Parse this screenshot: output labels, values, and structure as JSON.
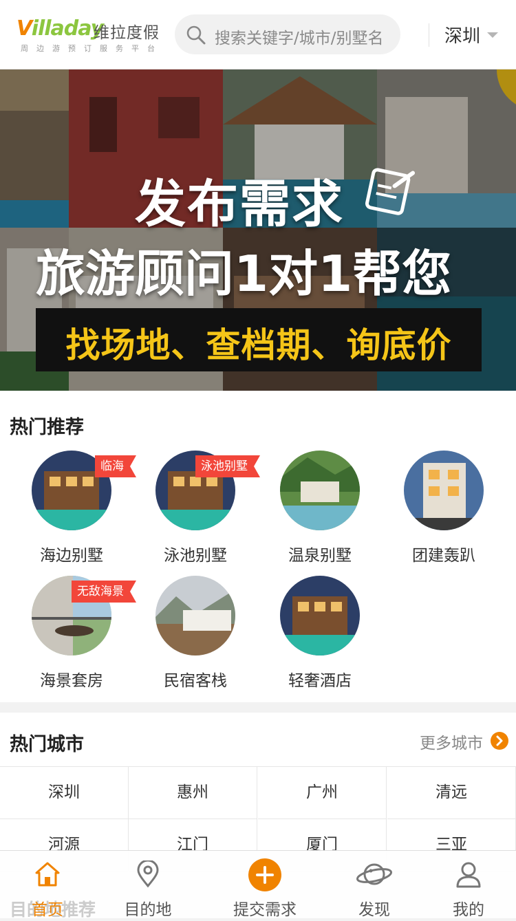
{
  "header": {
    "logo_en_v": "V",
    "logo_en_rest": "illaday",
    "logo_cn": "维拉度假",
    "logo_sub": "周边游预订服务平台",
    "search_placeholder": "搜索关键字/城市/别墅名",
    "city": "深圳"
  },
  "banner": {
    "title": "发布需求",
    "subtitle": "旅游顾问1对1帮您",
    "tagline": "找场地、查档期、询底价"
  },
  "recommend": {
    "title": "热门推荐",
    "items": [
      {
        "label": "海边别墅",
        "tag": "临海"
      },
      {
        "label": "泳池别墅",
        "tag": "泳池别墅"
      },
      {
        "label": "温泉别墅",
        "tag": ""
      },
      {
        "label": "团建轰趴",
        "tag": ""
      },
      {
        "label": "海景套房",
        "tag": "无敌海景"
      },
      {
        "label": "民宿客栈",
        "tag": ""
      },
      {
        "label": "轻奢酒店",
        "tag": ""
      }
    ]
  },
  "cities": {
    "title": "热门城市",
    "more": "更多城市",
    "items": [
      "深圳",
      "惠州",
      "广州",
      "清远",
      "河源",
      "江门",
      "厦门",
      "三亚"
    ]
  },
  "next_section_peek": "目的地推荐",
  "tabbar": {
    "items": [
      {
        "label": "首页",
        "icon": "home-icon"
      },
      {
        "label": "目的地",
        "icon": "location-pin-icon"
      },
      {
        "label": "提交需求",
        "icon": "plus-circle-icon"
      },
      {
        "label": "发现",
        "icon": "planet-icon"
      },
      {
        "label": "我的",
        "icon": "user-icon"
      }
    ],
    "active_color": "#f08300"
  }
}
